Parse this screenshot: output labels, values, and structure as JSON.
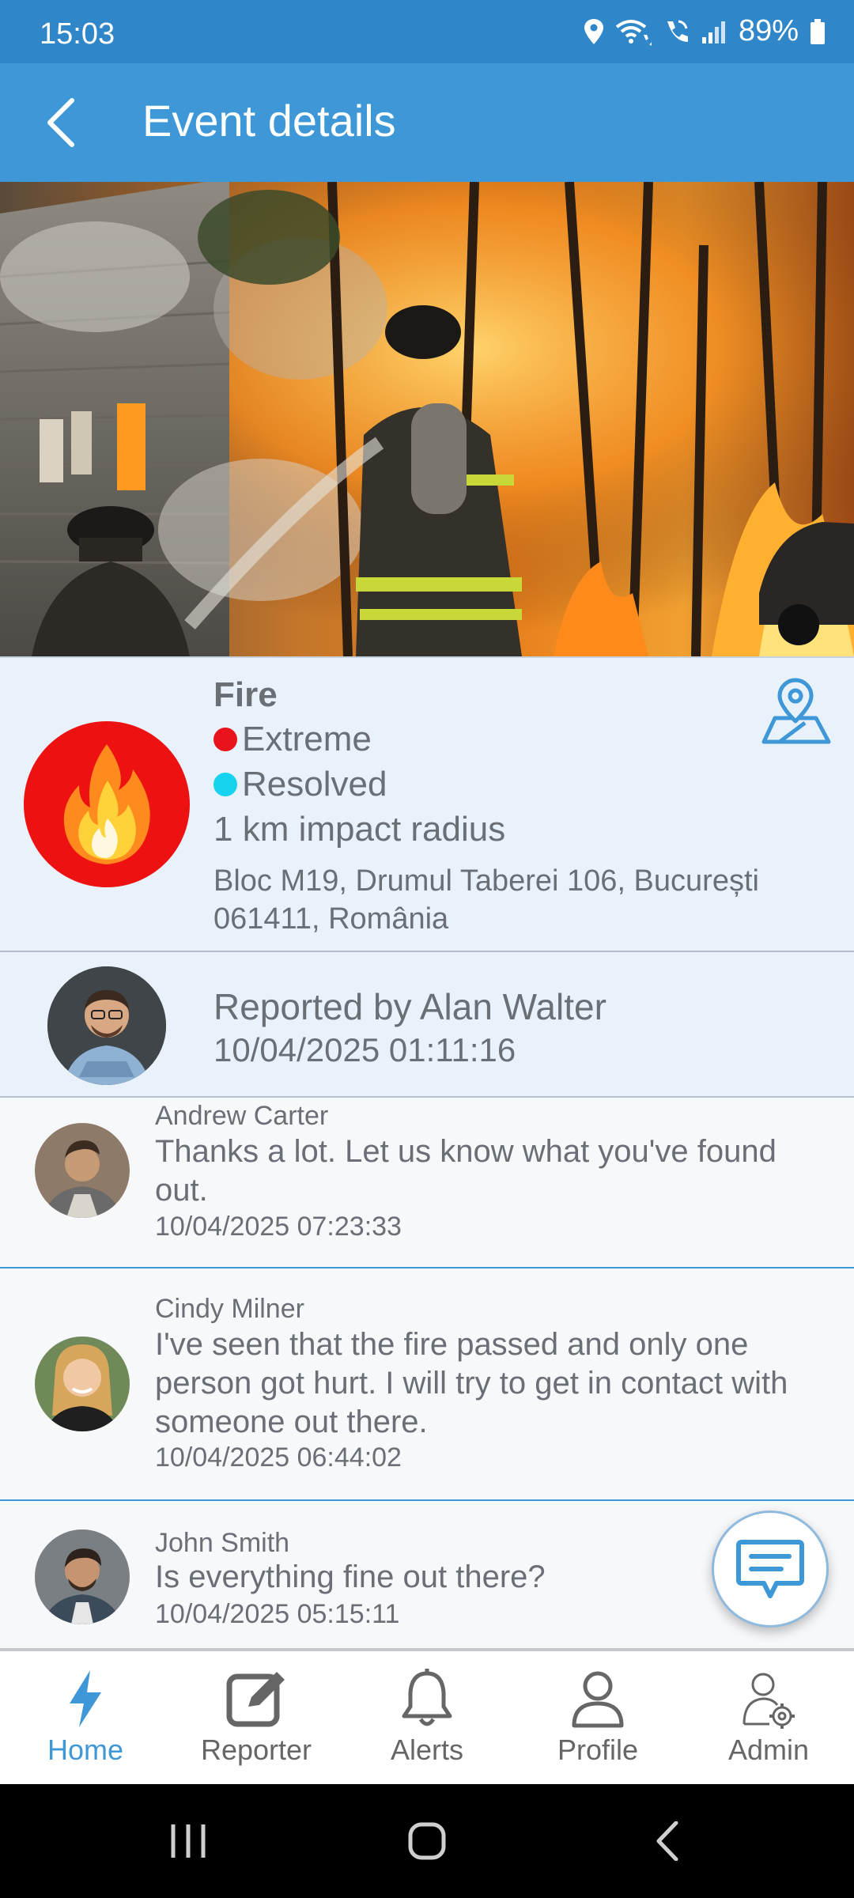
{
  "status": {
    "time": "15:03",
    "battery": "89%"
  },
  "header": {
    "title": "Event details"
  },
  "event": {
    "type": "Fire",
    "severity": "Extreme",
    "severity_color": "#e8131b",
    "status": "Resolved",
    "status_color": "#18d3f0",
    "radius": "1 km impact radius",
    "address": "Bloc M19, Drumul Taberei 106, București 061411, România"
  },
  "reporter": {
    "label": "Reported by Alan Walter",
    "timestamp": "10/04/2025 01:11:16"
  },
  "comments": [
    {
      "author": "Andrew Carter",
      "text": "Thanks a lot. Let us know what you've found out.",
      "timestamp": "10/04/2025 07:23:33"
    },
    {
      "author": "Cindy Milner",
      "text": "I've seen that the fire passed and only one person got hurt. I will try to get in contact with someone out there.",
      "timestamp": "10/04/2025 06:44:02"
    },
    {
      "author": "John Smith",
      "text": "Is everything fine out there?",
      "timestamp": "10/04/2025 05:15:11"
    }
  ],
  "nav": [
    {
      "label": "Home",
      "icon": "lightning-icon",
      "active": true
    },
    {
      "label": "Reporter",
      "icon": "edit-icon"
    },
    {
      "label": "Alerts",
      "icon": "bell-icon"
    },
    {
      "label": "Profile",
      "icon": "user-icon"
    },
    {
      "label": "Admin",
      "icon": "admin-gear-icon"
    }
  ],
  "colors": {
    "primary": "#3e97d6",
    "status_bar": "#2f86c9",
    "card_bg": "#e9f1fb",
    "fire_badge": "#ee1111"
  }
}
